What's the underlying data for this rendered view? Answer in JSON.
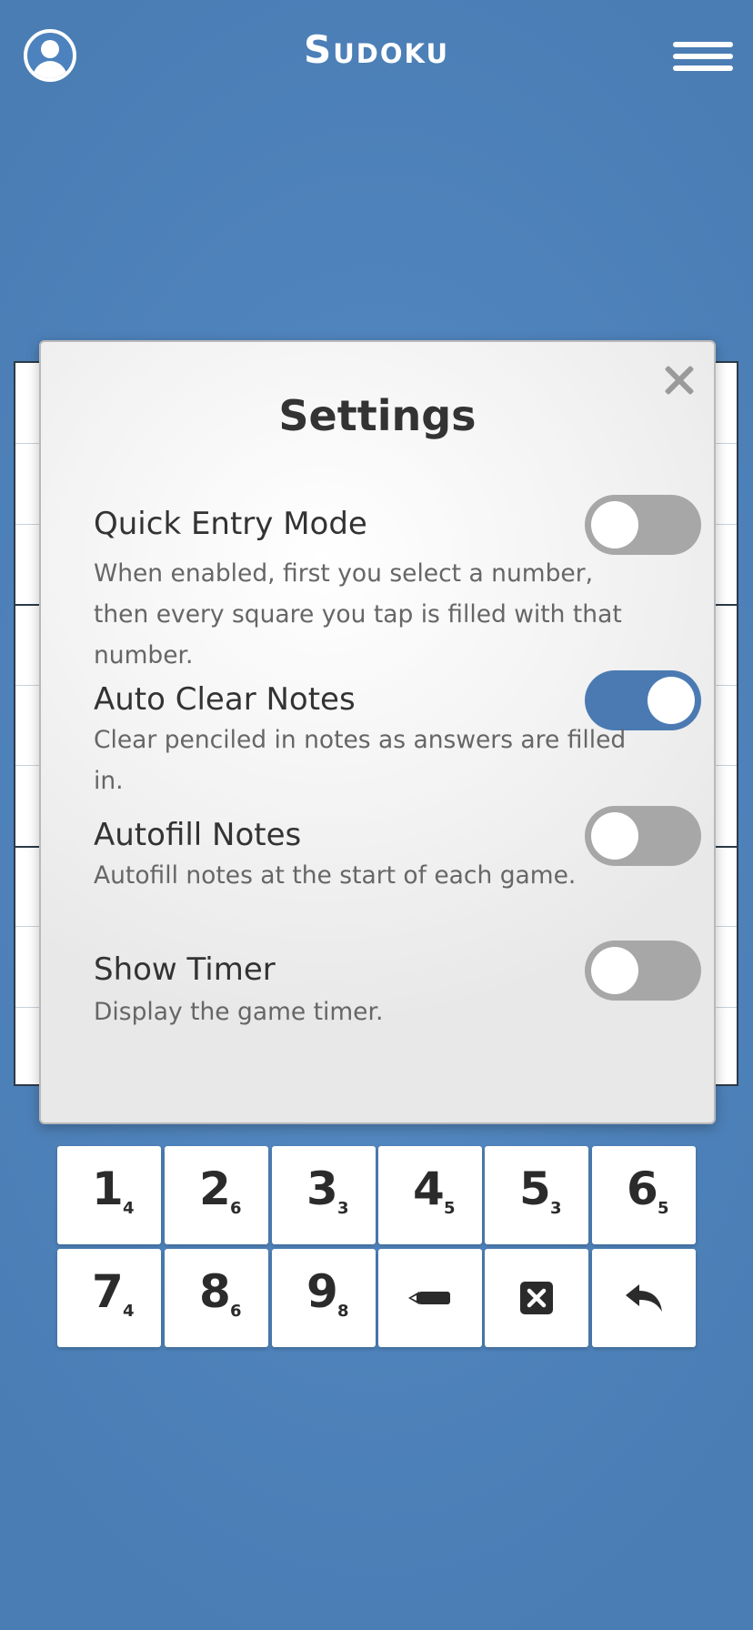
{
  "header": {
    "title": "Sudoku",
    "profile_icon": "user-circle-icon",
    "menu_icon": "hamburger-menu-icon"
  },
  "settings": {
    "title": "Settings",
    "close_icon": "close-icon",
    "items": [
      {
        "label": "Quick Entry Mode",
        "description": "When enabled, first you select a number, then every square you tap is filled with that number.",
        "enabled": false
      },
      {
        "label": "Auto Clear Notes",
        "description": "Clear penciled in notes as answers are filled in.",
        "enabled": true
      },
      {
        "label": "Autofill Notes",
        "description": "Autofill notes at the start of each game.",
        "enabled": false
      },
      {
        "label": "Show Timer",
        "description": "Display the game timer.",
        "enabled": false
      }
    ]
  },
  "numpad": {
    "keys": [
      {
        "digit": "1",
        "count": "4"
      },
      {
        "digit": "2",
        "count": "6"
      },
      {
        "digit": "3",
        "count": "3"
      },
      {
        "digit": "4",
        "count": "5"
      },
      {
        "digit": "5",
        "count": "3"
      },
      {
        "digit": "6",
        "count": "5"
      },
      {
        "digit": "7",
        "count": "4"
      },
      {
        "digit": "8",
        "count": "6"
      },
      {
        "digit": "9",
        "count": "8"
      }
    ],
    "pencil_icon": "pencil-icon",
    "erase_icon": "erase-icon",
    "undo_icon": "undo-icon"
  },
  "colors": {
    "background": "#4f83bb",
    "toggle_on": "#4b7ab3",
    "toggle_off": "#a7a7a7"
  }
}
